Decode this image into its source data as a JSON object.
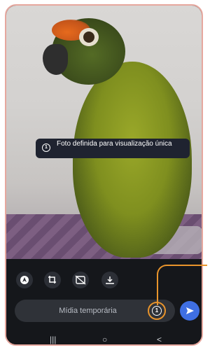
{
  "toast": {
    "text": "Foto definida para visualização única",
    "icon": "view-once-icon"
  },
  "toolbar": {
    "items": [
      {
        "name": "edit-icon"
      },
      {
        "name": "crop-rotate-icon"
      },
      {
        "name": "hd-off-icon"
      },
      {
        "name": "download-icon"
      }
    ]
  },
  "composer": {
    "placeholder": "Mídia temporária",
    "timer_icon_text": "1",
    "send_icon": "send-icon"
  },
  "navbar": {
    "recents": "|||",
    "home": "○",
    "back": "<"
  },
  "colors": {
    "accent": "#e8942c",
    "send": "#3f6fe3",
    "frame": "#e6a79e"
  }
}
